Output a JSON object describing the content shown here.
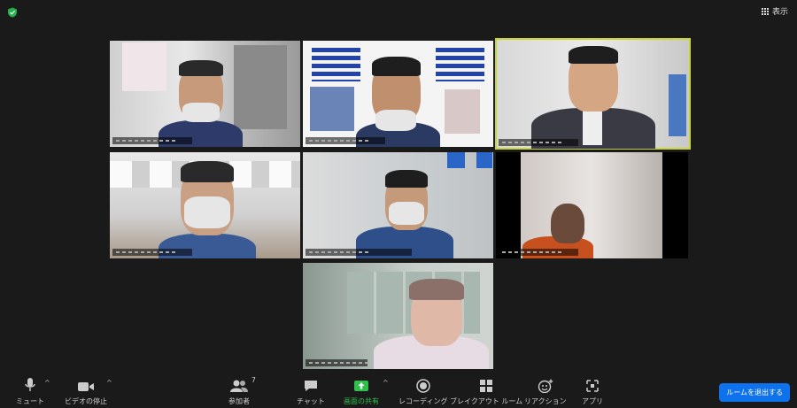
{
  "top": {
    "view_label": "表示"
  },
  "participants_count": "7",
  "toolbar": {
    "mute": "ミュート",
    "stop_video": "ビデオの停止",
    "participants": "参加者",
    "chat": "チャット",
    "share_screen": "画面の共有",
    "recording": "レコーディング",
    "breakout": "ブレイクアウト ルーム",
    "reactions": "リアクション",
    "apps": "アプリ"
  },
  "leave_button": "ルームを退出する",
  "colors": {
    "accent_green": "#2fbf4a",
    "active_speaker": "#c9d630",
    "leave_blue": "#0e72ed"
  }
}
